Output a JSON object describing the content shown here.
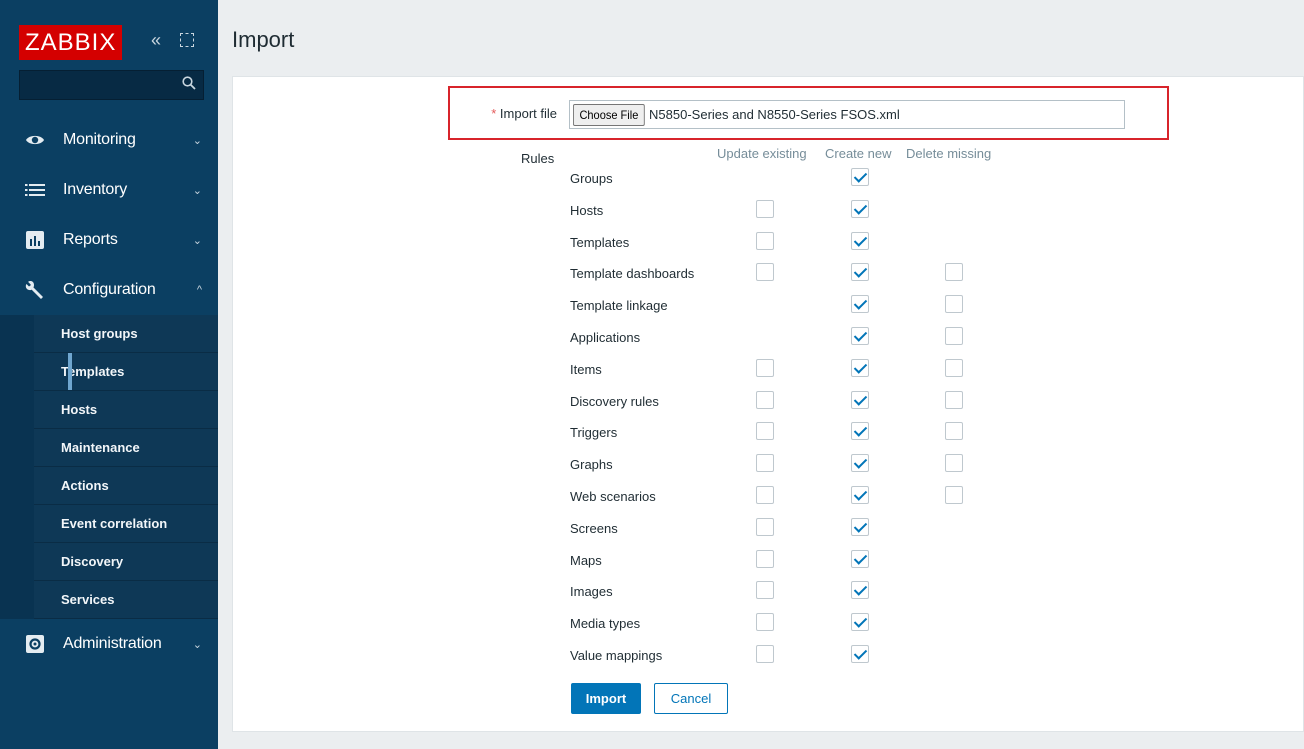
{
  "app": {
    "logo": "ZABBIX",
    "collapse_glyph": "«",
    "brand_color": "#d40000",
    "sidebar_color": "#0b3f62"
  },
  "search": {
    "placeholder": "",
    "value": ""
  },
  "menu": [
    {
      "label": "Monitoring",
      "icon": "eye-icon",
      "caret": "⌄"
    },
    {
      "label": "Inventory",
      "icon": "list-icon",
      "caret": "⌄"
    },
    {
      "label": "Reports",
      "icon": "bar-chart-icon",
      "caret": "⌄"
    },
    {
      "label": "Configuration",
      "icon": "wrench-icon",
      "caret": "^"
    },
    {
      "label": "Administration",
      "icon": "gear-icon",
      "caret": "⌄"
    }
  ],
  "configuration_submenu": [
    {
      "label": "Host groups"
    },
    {
      "label": "Templates",
      "selected": true
    },
    {
      "label": "Hosts"
    },
    {
      "label": "Maintenance"
    },
    {
      "label": "Actions"
    },
    {
      "label": "Event correlation"
    },
    {
      "label": "Discovery"
    },
    {
      "label": "Services"
    }
  ],
  "page": {
    "title": "Import"
  },
  "form": {
    "import_file_required_mark": "*",
    "import_file_label": "Import file",
    "choose_file_label": "Choose File",
    "file_name": "N5850-Series and N8550-Series FSOS.xml",
    "rules_label": "Rules",
    "columns": {
      "update_existing": "Update existing",
      "create_new": "Create new",
      "delete_missing": "Delete missing"
    },
    "rules": [
      {
        "label": "Groups",
        "update": null,
        "create": true,
        "delete": null
      },
      {
        "label": "Hosts",
        "update": false,
        "create": true,
        "delete": null
      },
      {
        "label": "Templates",
        "update": false,
        "create": true,
        "delete": null
      },
      {
        "label": "Template dashboards",
        "update": false,
        "create": true,
        "delete": false
      },
      {
        "label": "Template linkage",
        "update": null,
        "create": true,
        "delete": false
      },
      {
        "label": "Applications",
        "update": null,
        "create": true,
        "delete": false
      },
      {
        "label": "Items",
        "update": false,
        "create": true,
        "delete": false
      },
      {
        "label": "Discovery rules",
        "update": false,
        "create": true,
        "delete": false
      },
      {
        "label": "Triggers",
        "update": false,
        "create": true,
        "delete": false
      },
      {
        "label": "Graphs",
        "update": false,
        "create": true,
        "delete": false
      },
      {
        "label": "Web scenarios",
        "update": false,
        "create": true,
        "delete": false
      },
      {
        "label": "Screens",
        "update": false,
        "create": true,
        "delete": null
      },
      {
        "label": "Maps",
        "update": false,
        "create": true,
        "delete": null
      },
      {
        "label": "Images",
        "update": false,
        "create": true,
        "delete": null
      },
      {
        "label": "Media types",
        "update": false,
        "create": true,
        "delete": null
      },
      {
        "label": "Value mappings",
        "update": false,
        "create": true,
        "delete": null
      }
    ],
    "import_button": "Import",
    "cancel_button": "Cancel",
    "accent_color": "#0275b8"
  }
}
